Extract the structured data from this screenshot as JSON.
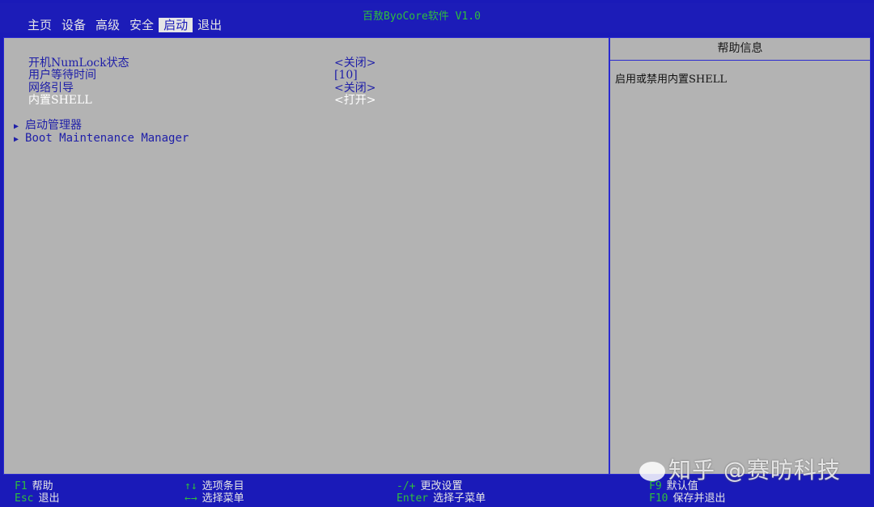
{
  "header": {
    "app_title": "百敖ByoCore软件 V1.0",
    "tabs": [
      "主页",
      "设备",
      "高级",
      "安全",
      "启动",
      "退出"
    ],
    "active_tab": 4
  },
  "options": [
    {
      "label": "开机NumLock状态",
      "value": "<关闭>"
    },
    {
      "label": "用户等待时间",
      "value": "[10]"
    },
    {
      "label": "网络引导",
      "value": "<关闭>"
    },
    {
      "label": "内置SHELL",
      "value": "<打开>",
      "selected": true
    }
  ],
  "submenus": [
    {
      "label": "启动管理器"
    },
    {
      "label": "Boot Maintenance Manager"
    }
  ],
  "help": {
    "title": "帮助信息",
    "text": "启用或禁用内置SHELL"
  },
  "footer": [
    {
      "key": "F1",
      "desc": "帮助"
    },
    {
      "key": "Esc",
      "desc": "退出"
    },
    {
      "key": "↑↓",
      "desc": "选项条目"
    },
    {
      "key": "←→",
      "desc": "选择菜单"
    },
    {
      "key": "-/+",
      "desc": "更改设置"
    },
    {
      "key": "Enter",
      "desc": "选择子菜单"
    },
    {
      "key": "F9",
      "desc": "默认值"
    },
    {
      "key": "F10",
      "desc": "保存并退出"
    }
  ],
  "watermark": "知乎 @赛昉科技",
  "colors": {
    "background_blue": "#1a1ab8",
    "panel_gray": "#b3b3b3",
    "key_green": "#2fbf3c"
  }
}
